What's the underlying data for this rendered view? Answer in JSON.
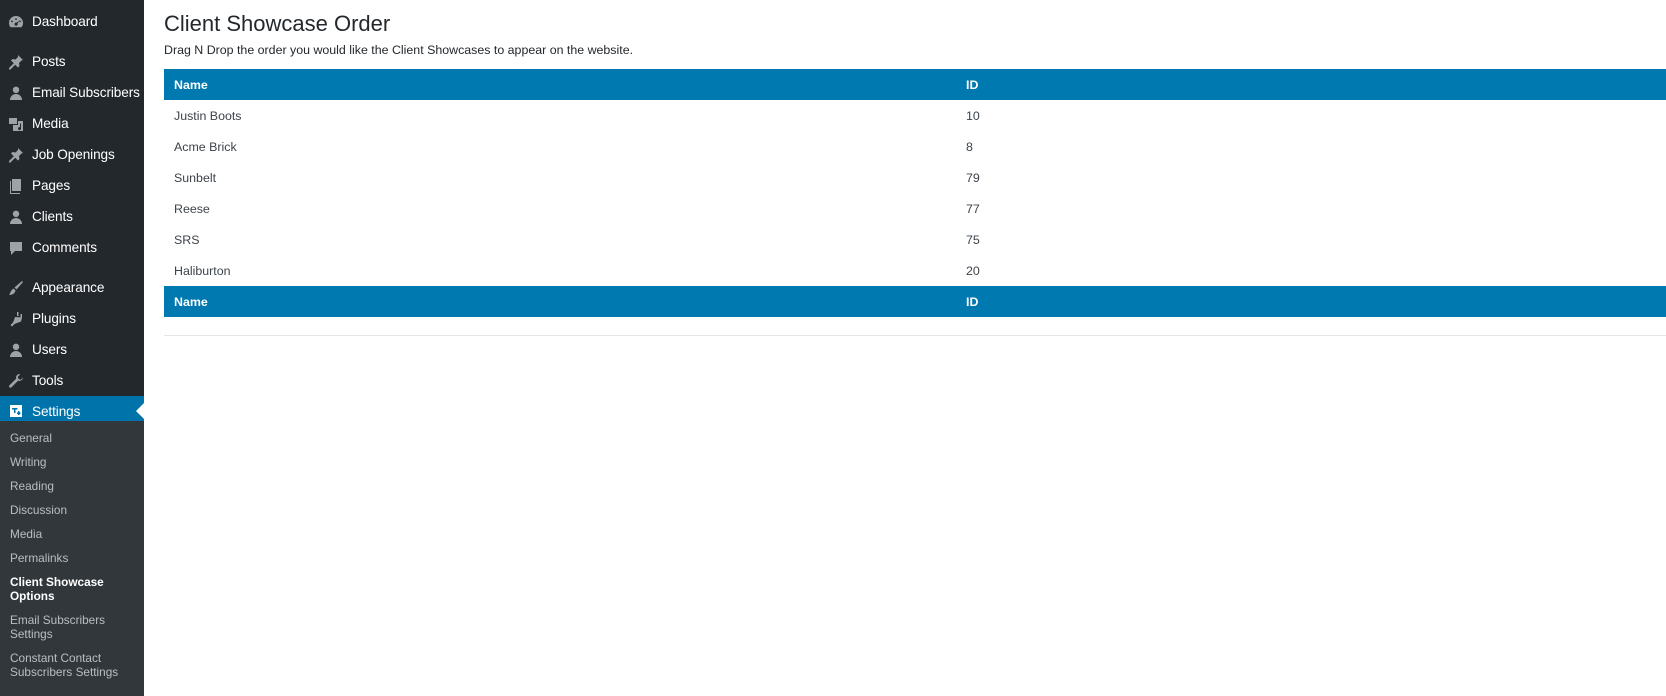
{
  "sidebar": {
    "items": [
      {
        "label": "Dashboard",
        "icon": "dashboard-icon"
      },
      {
        "label": "Posts",
        "icon": "pin-icon"
      },
      {
        "label": "Email Subscribers",
        "icon": "user-icon"
      },
      {
        "label": "Media",
        "icon": "media-icon"
      },
      {
        "label": "Job Openings",
        "icon": "pin-icon"
      },
      {
        "label": "Pages",
        "icon": "pages-icon"
      },
      {
        "label": "Clients",
        "icon": "user-icon"
      },
      {
        "label": "Comments",
        "icon": "comment-icon"
      },
      {
        "label": "Appearance",
        "icon": "brush-icon"
      },
      {
        "label": "Plugins",
        "icon": "plugin-icon"
      },
      {
        "label": "Users",
        "icon": "user-icon"
      },
      {
        "label": "Tools",
        "icon": "wrench-icon"
      },
      {
        "label": "Settings",
        "icon": "settings-icon"
      }
    ],
    "submenu": [
      "General",
      "Writing",
      "Reading",
      "Discussion",
      "Media",
      "Permalinks",
      "Client Showcase Options",
      "Email Subscribers Settings",
      "Constant Contact Subscribers Settings"
    ],
    "current_submenu": "Client Showcase Options"
  },
  "page": {
    "title": "Client Showcase Order",
    "description": "Drag N Drop the order you would like the Client Showcases to appear on the website."
  },
  "table": {
    "columns": [
      "Name",
      "ID"
    ],
    "rows": [
      {
        "name": "Justin Boots",
        "id": "10"
      },
      {
        "name": "Acme Brick",
        "id": "8"
      },
      {
        "name": "Sunbelt",
        "id": "79"
      },
      {
        "name": "Reese",
        "id": "77"
      },
      {
        "name": "SRS",
        "id": "75"
      },
      {
        "name": "Haliburton",
        "id": "20"
      }
    ]
  },
  "colors": {
    "sidebar_bg": "#23282d",
    "submenu_bg": "#32373c",
    "accent": "#0073aa",
    "table_header": "#0079b0"
  }
}
